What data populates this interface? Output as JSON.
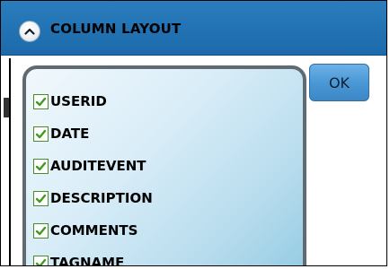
{
  "header": {
    "title": "COLUMN LAYOUT",
    "collapse_icon": "chevron-up-icon"
  },
  "columns": [
    {
      "label": "USERID",
      "checked": true
    },
    {
      "label": "DATE",
      "checked": true
    },
    {
      "label": "AUDITEVENT",
      "checked": true
    },
    {
      "label": "DESCRIPTION",
      "checked": true
    },
    {
      "label": "COMMENTS",
      "checked": true
    },
    {
      "label": "TAGNAME",
      "checked": true
    }
  ],
  "ok_button": {
    "label": "OK"
  },
  "colors": {
    "header_blue": "#2a7dbd",
    "check_green": "#3f9a1f",
    "button_blue": "#4a98d6"
  }
}
